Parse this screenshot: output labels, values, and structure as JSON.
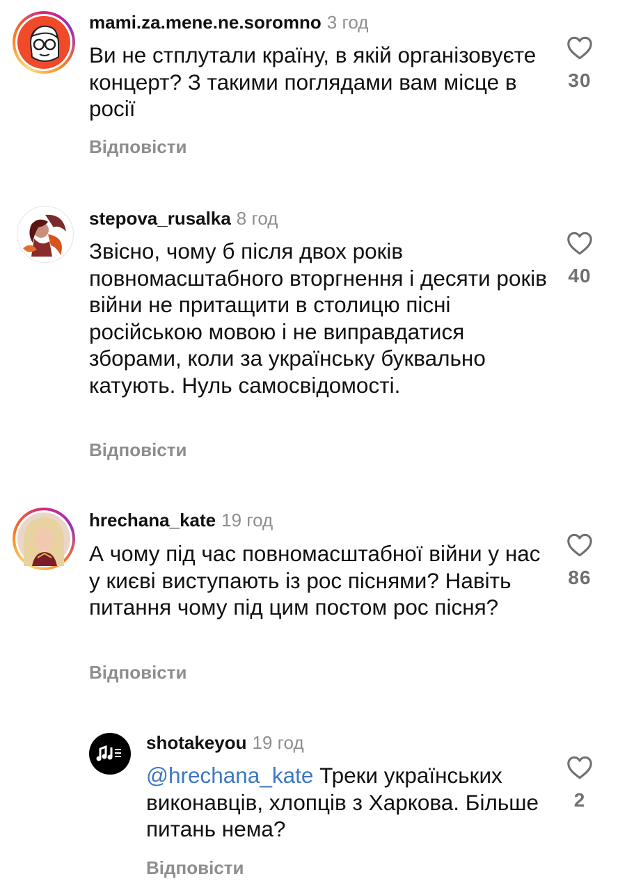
{
  "comments": [
    {
      "username": "mami.za.mene.ne.soromno",
      "time": "3 год",
      "text": "Ви не стплутали країну, в якій організовуєте концерт? З такими поглядами вам місце в росії",
      "likes": "30",
      "reply_label": "Відповісти",
      "avatar": "cartoon-face-avatar",
      "has_story_ring": true
    },
    {
      "username": "stepova_rusalka",
      "time": "8 год",
      "text": "Звісно, чому б після двох років повномасштабного вторгнення і десяти років війни не притащити в столицю пісні російською мовою і не виправдатися зборами, коли за українську буквально катують. Нуль самосвідомості.",
      "likes": "40",
      "reply_label": "Відповісти",
      "avatar": "dragon-illustration-avatar",
      "has_story_ring": false
    },
    {
      "username": "hrechana_kate",
      "time": "19 год",
      "text": "А чому під час повномасштабної війни у нас у києві виступають із рос піснями?  Навіть питання чому під цим постом рос пісня?",
      "likes": "86",
      "reply_label": "Відповісти",
      "avatar": "photo-avatar",
      "has_story_ring": true
    },
    {
      "username": "shotakeyou",
      "time": "19 год",
      "mention": "@hrechana_kate",
      "text": " Треки українських виконавців, хлопців з Харкова. Більше питань нема?",
      "likes": "2",
      "reply_label": "Відповісти",
      "avatar": "music-logo-avatar",
      "has_story_ring": false,
      "is_reply": true
    }
  ],
  "colors": {
    "text": "#111111",
    "secondary": "#8e8e8e",
    "mention": "#3b78c4",
    "like_count": "#707070"
  }
}
